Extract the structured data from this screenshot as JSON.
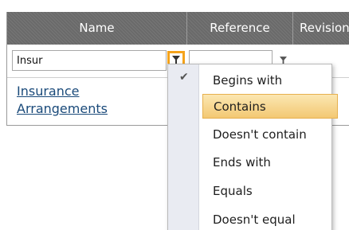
{
  "grid": {
    "columns": [
      "Name",
      "Reference",
      "Revision"
    ],
    "filter_value": "Insur",
    "row": {
      "name_line1": "Insurance",
      "name_line2": "Arrangements"
    }
  },
  "filter_menu": {
    "checked_item": "Begins with",
    "highlighted_item": "Contains",
    "items": [
      "Begins with",
      "Contains",
      "Doesn't contain",
      "Ends with",
      "Equals",
      "Doesn't equal"
    ]
  },
  "icons": {
    "filter": "filter-icon",
    "check": "checkmark-icon"
  },
  "colors": {
    "header_bg": "#707070",
    "active_filter_border": "#f5a31b",
    "menu_highlight": "#f7d88f",
    "link": "#1a4a7a"
  }
}
